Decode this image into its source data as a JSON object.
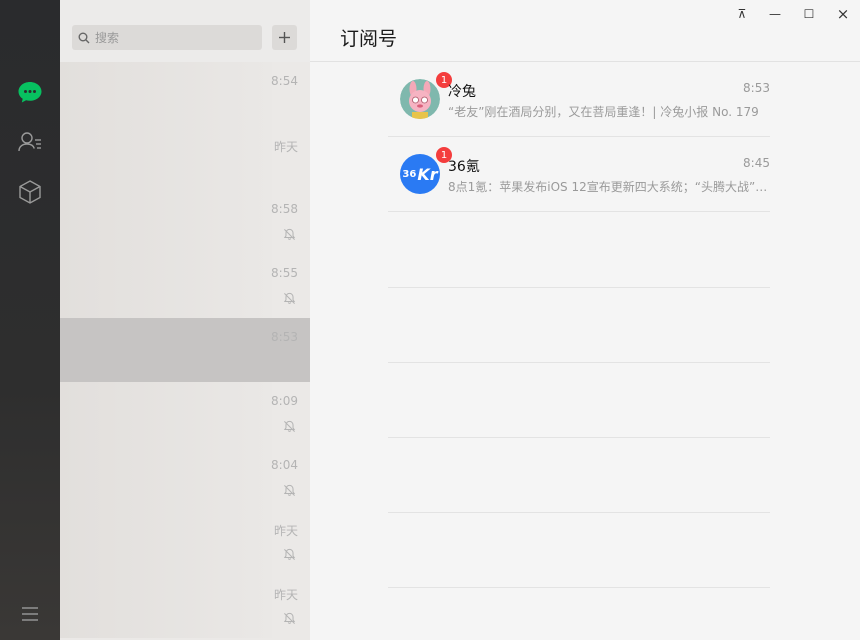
{
  "window": {
    "pin_symbol": "⊼",
    "minimize_symbol": "—",
    "maximize_symbol": "☐",
    "close_symbol": "×"
  },
  "nav": {
    "items": [
      {
        "name": "chat-icon",
        "active": true,
        "color": "#07c160"
      },
      {
        "name": "contacts-icon",
        "active": false
      },
      {
        "name": "cube-icon",
        "active": false
      }
    ],
    "menu_icon": "menu-icon"
  },
  "search": {
    "placeholder": "搜索"
  },
  "chat_list": [
    {
      "time": "8:54",
      "muted": false,
      "selected": false
    },
    {
      "time": "昨天",
      "muted": false,
      "selected": false
    },
    {
      "time": "8:58",
      "muted": true,
      "selected": false
    },
    {
      "time": "8:55",
      "muted": true,
      "selected": false
    },
    {
      "time": "8:53",
      "muted": false,
      "selected": true
    },
    {
      "time": "8:09",
      "muted": true,
      "selected": false
    },
    {
      "time": "8:04",
      "muted": true,
      "selected": false
    },
    {
      "time": "昨天",
      "muted": true,
      "selected": false
    },
    {
      "time": "昨天",
      "muted": true,
      "selected": false
    }
  ],
  "main": {
    "title": "订阅号",
    "subscriptions": [
      {
        "name": "冷兔",
        "time": "8:53",
        "unread": "1",
        "preview": "“老友”刚在酒局分别，又在菩局重逢！| 冷兔小报 No. 179",
        "avatar": "rabbit-avatar"
      },
      {
        "name": "36氪",
        "time": "8:45",
        "unread": "1",
        "preview": "8点1氪：苹果发布iOS 12宣布更新四大系统；“头腾大战”开打…",
        "avatar": "36kr-avatar",
        "avatar_text": "36",
        "avatar_text2": "Kr"
      }
    ]
  },
  "colors": {
    "accent_green": "#07c160",
    "badge_red": "#f43d3d",
    "kr_blue": "#2a7af3"
  }
}
